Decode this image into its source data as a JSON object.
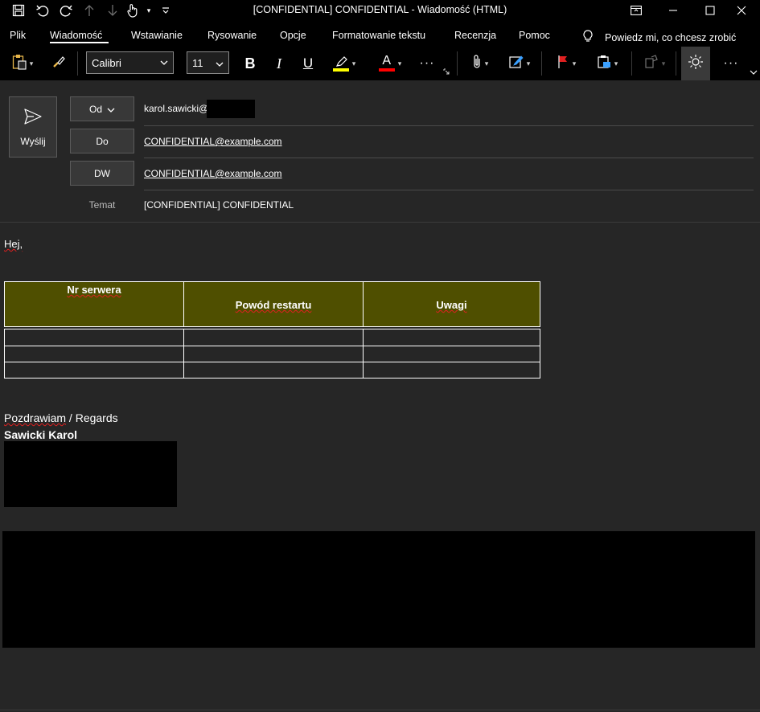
{
  "window": {
    "title": "[CONFIDENTIAL] CONFIDENTIAL  -  Wiadomość (HTML)"
  },
  "quick_access": [
    "save-icon",
    "undo-icon",
    "redo-icon",
    "up-arrow-icon",
    "down-arrow-icon",
    "touch-mode-icon",
    "customize-icon"
  ],
  "menu": {
    "tabs": [
      {
        "label": "Plik"
      },
      {
        "label": "Wiadomość"
      },
      {
        "label": "Wstawianie"
      },
      {
        "label": "Rysowanie"
      },
      {
        "label": "Opcje"
      },
      {
        "label": "Formatowanie tekstu"
      },
      {
        "label": "Recenzja"
      },
      {
        "label": "Pomoc"
      }
    ],
    "active_tab": "Wiadomość",
    "tell_me": "Powiedz mi, co chcesz zrobić"
  },
  "ribbon": {
    "font_name": "Calibri",
    "font_size": "11",
    "bold": "B",
    "italic": "I",
    "underline": "U",
    "font_color_letter": "A",
    "more": "···",
    "highlight_color": "#ffff00",
    "font_color": "#ff0000"
  },
  "header": {
    "send_label": "Wyślij",
    "from_label": "Od",
    "from_value": "karol.sawicki@",
    "to_label": "Do",
    "to_value": "CONFIDENTIAL@example.com",
    "cc_label": "DW",
    "cc_value": "CONFIDENTIAL@example.com",
    "subject_label": "Temat",
    "subject_value": "[CONFIDENTIAL] CONFIDENTIAL"
  },
  "body": {
    "greeting": "Hej,",
    "table": {
      "headers": [
        "Nr serwera",
        "Powód restartu",
        "Uwagi"
      ],
      "rows": [
        [
          "",
          "",
          ""
        ],
        [
          "",
          "",
          ""
        ],
        [
          "",
          "",
          ""
        ]
      ]
    },
    "signature": {
      "regards_pl": "Pozdrawiam",
      "regards_sep": " / ",
      "regards_en": "Regards",
      "name": "Sawicki Karol"
    }
  },
  "colors": {
    "chrome": "#000000",
    "background": "#262626",
    "table_header": "#4f4f00",
    "spellcheck": "#e02020"
  }
}
